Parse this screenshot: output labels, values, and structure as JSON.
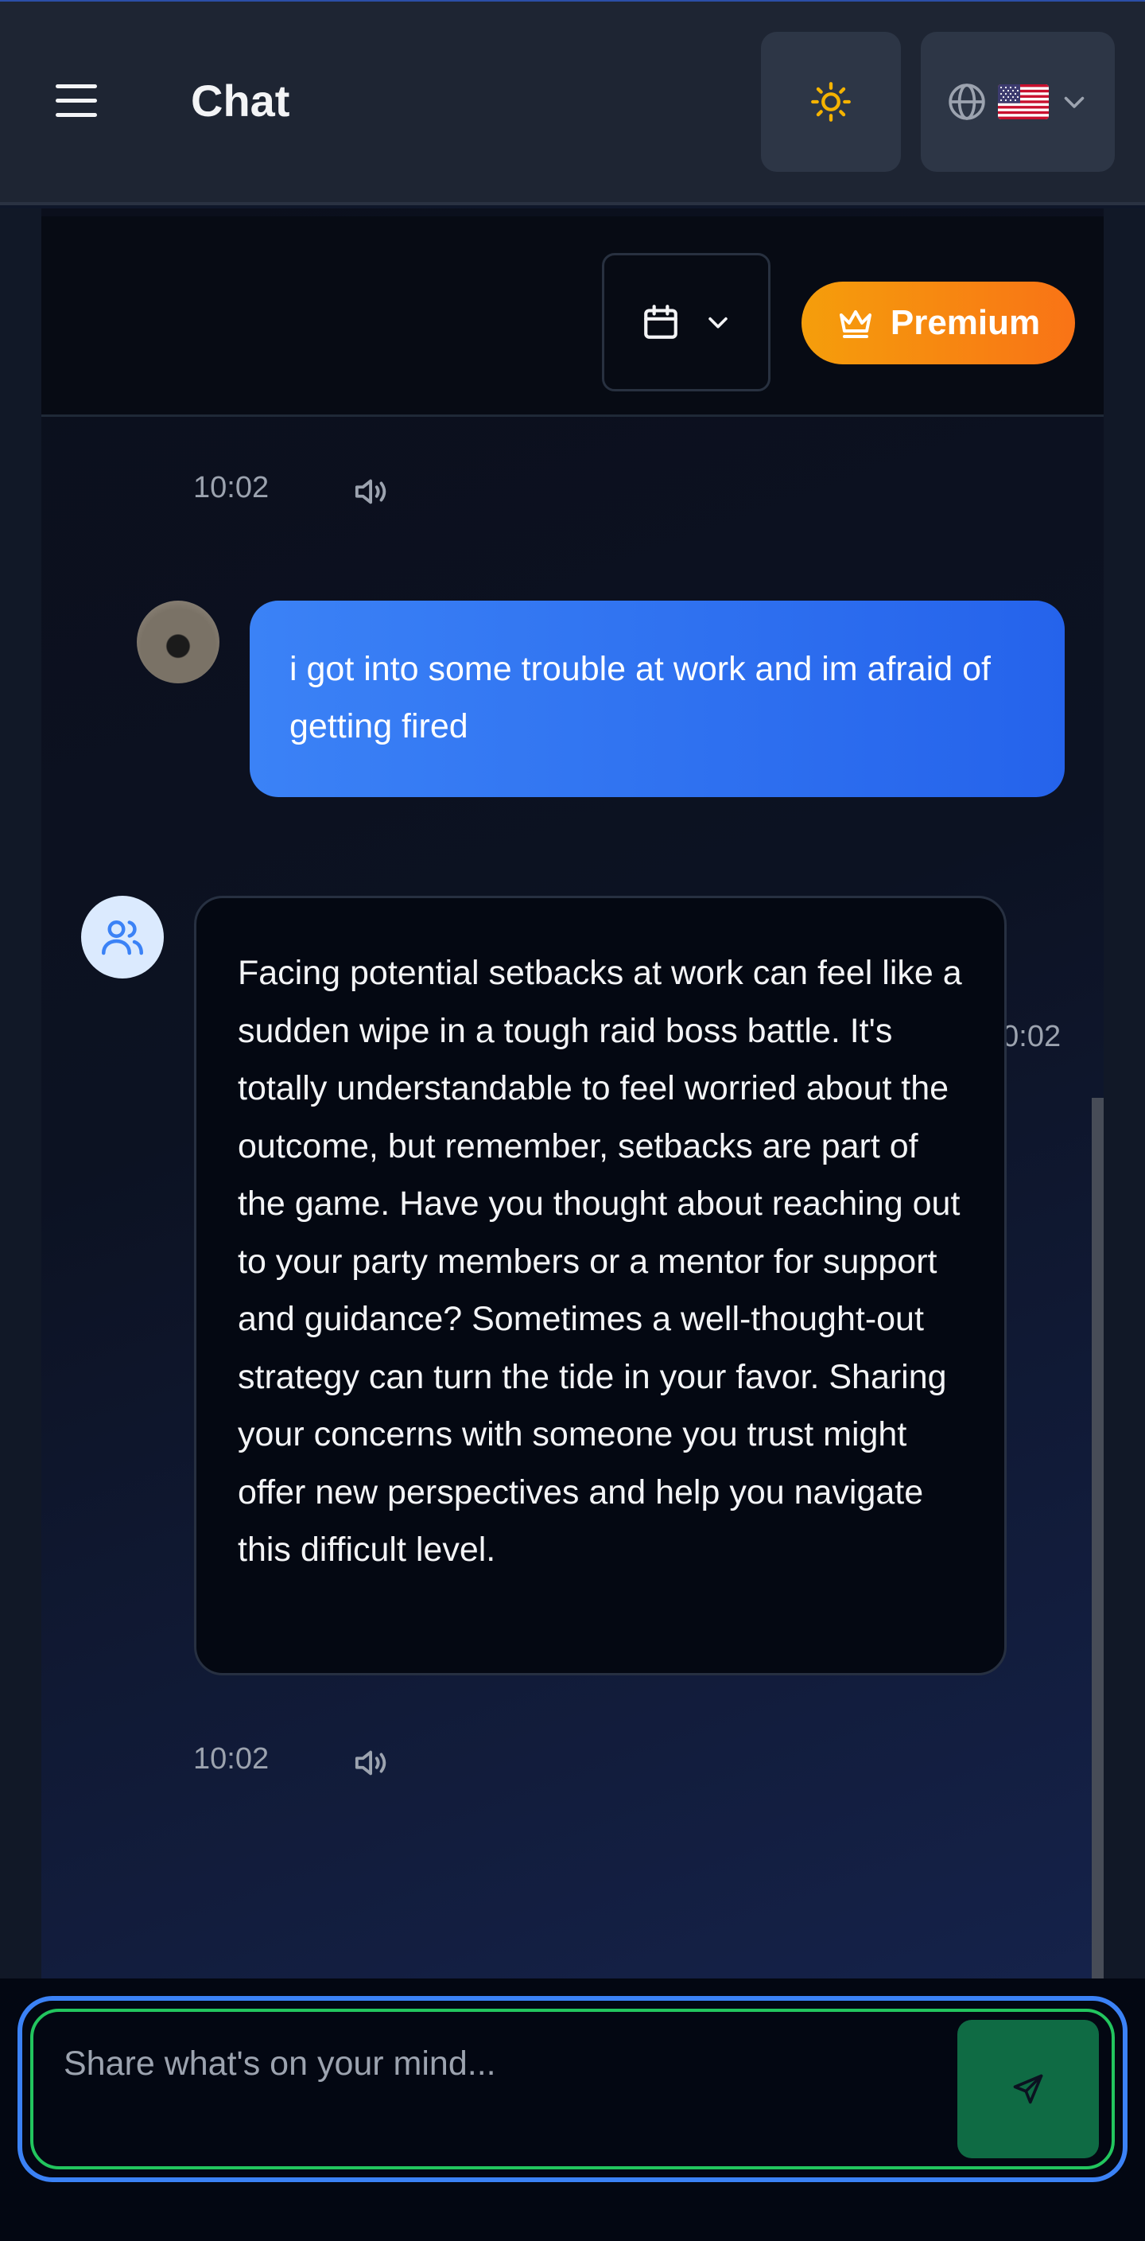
{
  "header": {
    "title": "Chat",
    "menu_icon": "hamburger-menu-icon",
    "theme_icon": "sun-icon",
    "language_icon": "globe-icon",
    "flag": "us-flag",
    "dropdown_icon": "chevron-down-icon"
  },
  "toolbar": {
    "date_icon": "calendar-icon",
    "premium_label": "Premium",
    "premium_icon": "crown-icon"
  },
  "messages": [
    {
      "role": "assistant_meta",
      "time": "10:02"
    },
    {
      "role": "user",
      "text": "i got into some trouble at work and im afraid of getting fired",
      "time": "10:02"
    },
    {
      "role": "assistant",
      "text": "Facing potential setbacks at work can feel like a sudden wipe in a tough raid boss battle. It's totally understandable to feel worried about the outcome, but remember, setbacks are part of the game. Have you thought about reaching out to your party members or a mentor for support and guidance? Sometimes a well-thought-out strategy can turn the tide in your favor. Sharing your concerns with someone you trust might offer new perspectives and help you navigate this difficult level.",
      "time": "10:02"
    }
  ],
  "composer": {
    "placeholder": "Share what's on your mind...",
    "value": "",
    "send_icon": "send-icon"
  },
  "colors": {
    "accent_blue": "#3b82f6",
    "premium_orange": "#f59e0b",
    "send_green": "#0f6b44",
    "input_ring_green": "#22c55e"
  }
}
